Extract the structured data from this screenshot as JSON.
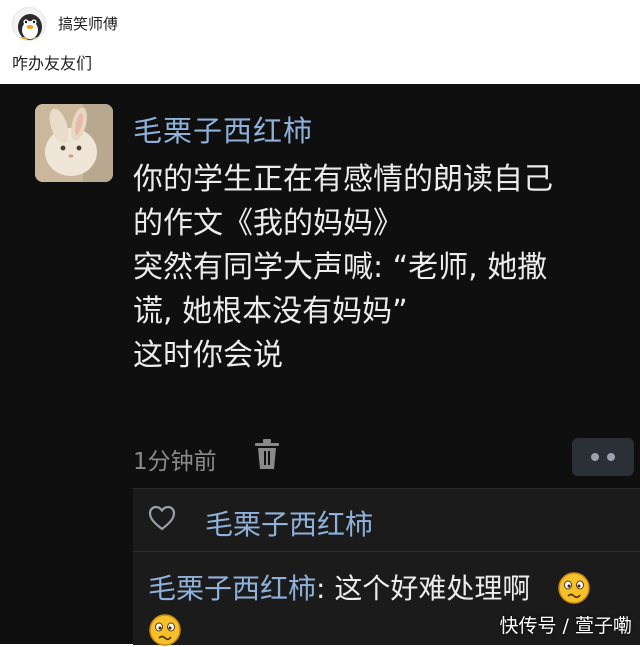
{
  "header": {
    "account_name": "搞笑师傅",
    "caption": "咋办友友们"
  },
  "post": {
    "author": "毛栗子西红柿",
    "lines": [
      "你的学生正在有感情的朗读自己",
      "的作文《我的妈妈》",
      "突然有同学大声喊: “老师, 她撒",
      "谎, 她根本没有妈妈”",
      "这时你会说"
    ],
    "time": "1分钟前"
  },
  "reply_section": {
    "liked_by": "毛栗子西红柿",
    "reply_author": "毛栗子西红柿",
    "reply_text": ": 这个好难处理啊"
  },
  "watermark": "快传号 / 萱子嘞",
  "colors": {
    "background_dark": "#0f0f0f",
    "name_blue": "#8fb0d9",
    "text": "#ececec",
    "meta_gray": "#8a8a8a"
  },
  "icons": [
    "penguin-avatar-icon",
    "rabbit-avatar",
    "trash-icon",
    "more-icon",
    "heart-icon",
    "confused-emoji-icon"
  ]
}
